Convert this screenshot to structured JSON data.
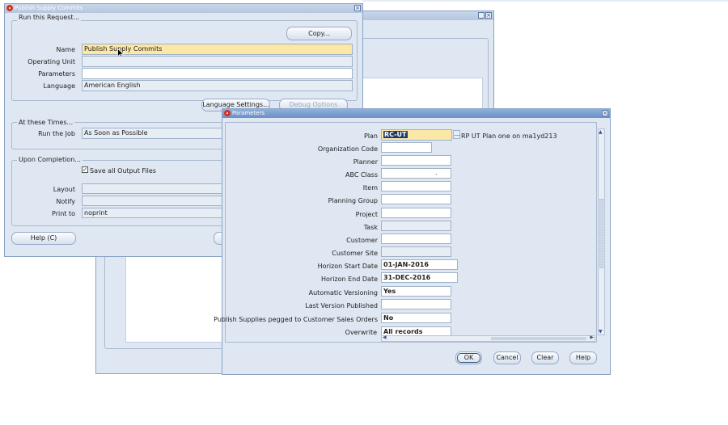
{
  "request_window": {
    "title": "Publish Supply Commits",
    "run_group_label": "Run this Request...",
    "copy_button": "Copy...",
    "name_label": "Name",
    "name_value": "Publish Supply Commits",
    "operating_unit_label": "Operating Unit",
    "operating_unit_value": "",
    "parameters_label": "Parameters",
    "parameters_value": "",
    "language_label": "Language",
    "language_value": "American English",
    "language_settings_button": "Language Settings...",
    "debug_options_button": "Debug Options",
    "times_group_label": "At these Times...",
    "run_job_label": "Run the Job",
    "run_job_value": "As Soon as Possible",
    "completion_group_label": "Upon Completion...",
    "save_output_label": "Save all Output Files",
    "save_output_checked": true,
    "layout_label": "Layout",
    "notify_label": "Notify",
    "print_to_label": "Print to",
    "print_to_value": "noprint",
    "help_button": "Help (C)"
  },
  "parameters_window": {
    "title": "Parameters",
    "plan_label": "Plan",
    "plan_value": "RC-UT",
    "plan_description": "RP UT Plan one on ma1yd213",
    "fields": [
      {
        "label": "Organization Code",
        "value": ""
      },
      {
        "label": "Planner",
        "value": ""
      },
      {
        "label": "ABC Class",
        "value": "."
      },
      {
        "label": "Item",
        "value": ""
      },
      {
        "label": "Planning Group",
        "value": ""
      },
      {
        "label": "Project",
        "value": ""
      },
      {
        "label": "Task",
        "value": ""
      },
      {
        "label": "Customer",
        "value": ""
      },
      {
        "label": "Customer Site",
        "value": ""
      },
      {
        "label": "Horizon Start Date",
        "value": "01-JAN-2016"
      },
      {
        "label": "Horizon End Date",
        "value": "31-DEC-2016"
      },
      {
        "label": "Automatic Versioning",
        "value": "Yes"
      },
      {
        "label": "Last Version Published",
        "value": ""
      },
      {
        "label": "Publish Supplies pegged to Customer Sales Orders",
        "value": "No"
      },
      {
        "label": "Overwrite",
        "value": "All records"
      }
    ],
    "ok_button": "OK",
    "cancel_button": "Cancel",
    "clear_button": "Clear",
    "help_button": "Help"
  }
}
